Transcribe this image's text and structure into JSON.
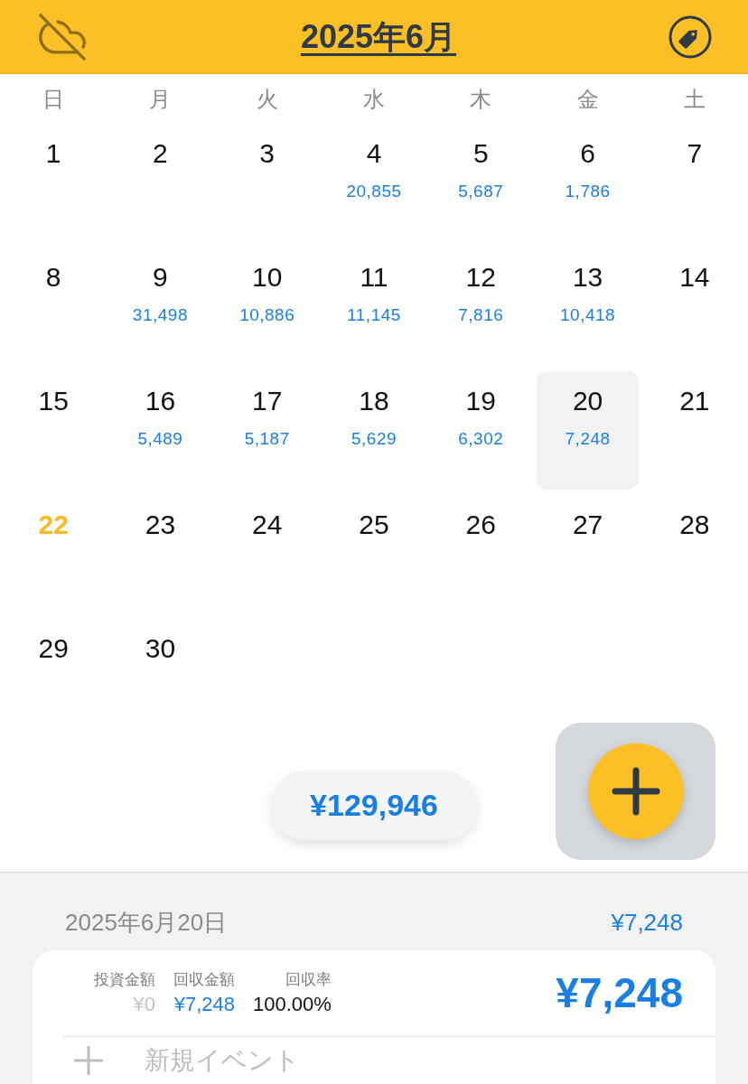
{
  "header": {
    "title": "2025年6月"
  },
  "weekdays": [
    "日",
    "月",
    "火",
    "水",
    "木",
    "金",
    "土"
  ],
  "weeks": [
    [
      {
        "day": "1",
        "selected": false,
        "today": false
      },
      {
        "day": "2",
        "selected": false,
        "today": false
      },
      {
        "day": "3",
        "selected": false,
        "today": false
      },
      {
        "day": "4",
        "amount": "20,855",
        "selected": false,
        "today": false
      },
      {
        "day": "5",
        "amount": "5,687",
        "selected": false,
        "today": false
      },
      {
        "day": "6",
        "amount": "1,786",
        "selected": false,
        "today": false
      },
      {
        "day": "7",
        "selected": false,
        "today": false
      }
    ],
    [
      {
        "day": "8",
        "selected": false,
        "today": false
      },
      {
        "day": "9",
        "amount": "31,498",
        "selected": false,
        "today": false
      },
      {
        "day": "10",
        "amount": "10,886",
        "selected": false,
        "today": false
      },
      {
        "day": "11",
        "amount": "11,145",
        "selected": false,
        "today": false
      },
      {
        "day": "12",
        "amount": "7,816",
        "selected": false,
        "today": false
      },
      {
        "day": "13",
        "amount": "10,418",
        "selected": false,
        "today": false
      },
      {
        "day": "14",
        "selected": false,
        "today": false
      }
    ],
    [
      {
        "day": "15",
        "selected": false,
        "today": false
      },
      {
        "day": "16",
        "amount": "5,489",
        "selected": false,
        "today": false
      },
      {
        "day": "17",
        "amount": "5,187",
        "selected": false,
        "today": false
      },
      {
        "day": "18",
        "amount": "5,629",
        "selected": false,
        "today": false
      },
      {
        "day": "19",
        "amount": "6,302",
        "selected": false,
        "today": false
      },
      {
        "day": "20",
        "amount": "7,248",
        "selected": true,
        "today": false
      },
      {
        "day": "21",
        "selected": false,
        "today": false
      }
    ],
    [
      {
        "day": "22",
        "selected": false,
        "today": true
      },
      {
        "day": "23",
        "selected": false,
        "today": false
      },
      {
        "day": "24",
        "selected": false,
        "today": false
      },
      {
        "day": "25",
        "selected": false,
        "today": false
      },
      {
        "day": "26",
        "selected": false,
        "today": false
      },
      {
        "day": "27",
        "selected": false,
        "today": false
      },
      {
        "day": "28",
        "selected": false,
        "today": false
      }
    ],
    [
      {
        "day": "29",
        "selected": false,
        "today": false
      },
      {
        "day": "30",
        "selected": false,
        "today": false
      }
    ]
  ],
  "monthly_total": "¥129,946",
  "detail": {
    "date": "2025年6月20日",
    "total": "¥7,248",
    "stats": [
      {
        "label": "投資金額",
        "value": "¥0",
        "kind": "zero"
      },
      {
        "label": "回収金額",
        "value": "¥7,248",
        "kind": "income"
      },
      {
        "label": "回収率",
        "value": "100.00%",
        "kind": "rate"
      }
    ],
    "amount": "¥7,248",
    "new_event": "新規イベント"
  }
}
